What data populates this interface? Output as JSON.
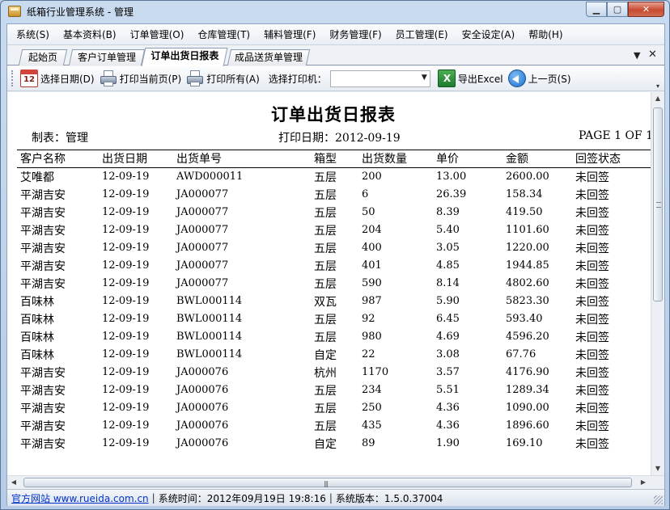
{
  "window": {
    "title": "纸箱行业管理系统 - 管理"
  },
  "menu": [
    "系统(S)",
    "基本资料(B)",
    "订单管理(O)",
    "仓库管理(T)",
    "辅料管理(F)",
    "财务管理(F)",
    "员工管理(E)",
    "安全设定(A)",
    "帮助(H)"
  ],
  "tabs": [
    {
      "label": "起始页",
      "active": false
    },
    {
      "label": "客户订单管理",
      "active": false
    },
    {
      "label": "订单出货日报表",
      "active": true
    },
    {
      "label": "成品送货单管理",
      "active": false
    }
  ],
  "tab_controls": {
    "dropdown": "▼",
    "close": "✕"
  },
  "toolbar": {
    "select_date": "选择日期(D)",
    "print_current": "打印当前页(P)",
    "print_all": "打印所有(A)",
    "printer_label": "选择打印机：",
    "printer_value": "",
    "export_excel": "导出Excel",
    "prev_page": "上一页(S)"
  },
  "report": {
    "title": "订单出货日报表",
    "maker": "制表：管理",
    "print_date": "打印日期：2012-09-19",
    "page": "PAGE 1 OF 1",
    "columns": [
      "客户名称",
      "出货日期",
      "出货单号",
      "箱型",
      "出货数量",
      "单价",
      "金额",
      "回签状态"
    ],
    "rows": [
      [
        "艾唯都",
        "12-09-19",
        "AWD000011",
        "五层",
        "200",
        "13.00",
        "2600.00",
        "未回签"
      ],
      [
        "平湖吉安",
        "12-09-19",
        "JA000077",
        "五层",
        "6",
        "26.39",
        "158.34",
        "未回签"
      ],
      [
        "平湖吉安",
        "12-09-19",
        "JA000077",
        "五层",
        "50",
        "8.39",
        "419.50",
        "未回签"
      ],
      [
        "平湖吉安",
        "12-09-19",
        "JA000077",
        "五层",
        "204",
        "5.40",
        "1101.60",
        "未回签"
      ],
      [
        "平湖吉安",
        "12-09-19",
        "JA000077",
        "五层",
        "400",
        "3.05",
        "1220.00",
        "未回签"
      ],
      [
        "平湖吉安",
        "12-09-19",
        "JA000077",
        "五层",
        "401",
        "4.85",
        "1944.85",
        "未回签"
      ],
      [
        "平湖吉安",
        "12-09-19",
        "JA000077",
        "五层",
        "590",
        "8.14",
        "4802.60",
        "未回签"
      ],
      [
        "百味林",
        "12-09-19",
        "BWL000114",
        "双瓦",
        "987",
        "5.90",
        "5823.30",
        "未回签"
      ],
      [
        "百味林",
        "12-09-19",
        "BWL000114",
        "五层",
        "92",
        "6.45",
        "593.40",
        "未回签"
      ],
      [
        "百味林",
        "12-09-19",
        "BWL000114",
        "五层",
        "980",
        "4.69",
        "4596.20",
        "未回签"
      ],
      [
        "百味林",
        "12-09-19",
        "BWL000114",
        "自定",
        "22",
        "3.08",
        "67.76",
        "未回签"
      ],
      [
        "平湖吉安",
        "12-09-19",
        "JA000076",
        "杭州",
        "1170",
        "3.57",
        "4176.90",
        "未回签"
      ],
      [
        "平湖吉安",
        "12-09-19",
        "JA000076",
        "五层",
        "234",
        "5.51",
        "1289.34",
        "未回签"
      ],
      [
        "平湖吉安",
        "12-09-19",
        "JA000076",
        "五层",
        "250",
        "4.36",
        "1090.00",
        "未回签"
      ],
      [
        "平湖吉安",
        "12-09-19",
        "JA000076",
        "五层",
        "435",
        "4.36",
        "1896.60",
        "未回签"
      ],
      [
        "平湖吉安",
        "12-09-19",
        "JA000076",
        "自定",
        "89",
        "1.90",
        "169.10",
        "未回签"
      ]
    ]
  },
  "status": {
    "site_link": "官方网站 www.rueida.com.cn",
    "system_time": "系统时间：2012年09月19日 19:8:16",
    "version": "系统版本：1.5.0.37004"
  },
  "colors": {
    "link": "#0033cc",
    "close_button": "#c74b32",
    "frame": "#bcd0e6"
  },
  "icons": [
    "calendar-icon",
    "printer-icon",
    "excel-icon",
    "back-arrow-icon"
  ]
}
